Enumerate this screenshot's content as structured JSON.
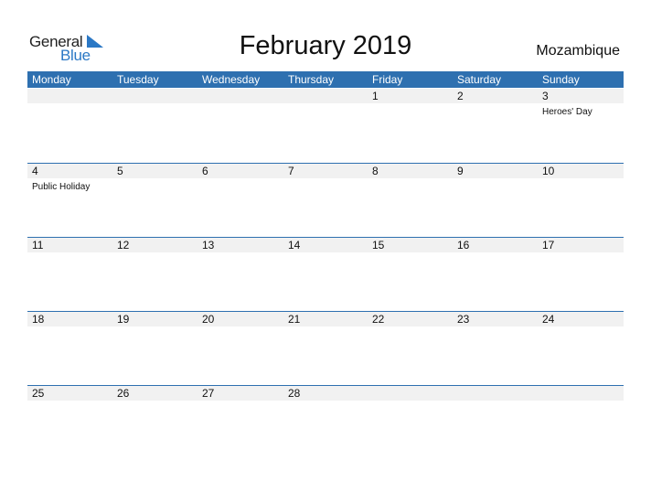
{
  "logo": {
    "line1": "General",
    "line2": "Blue",
    "accent_color": "#2b78c5"
  },
  "title": "February 2019",
  "country": "Mozambique",
  "header_color": "#2e70b0",
  "weekdays": [
    "Monday",
    "Tuesday",
    "Wednesday",
    "Thursday",
    "Friday",
    "Saturday",
    "Sunday"
  ],
  "weeks": [
    [
      {
        "day": ""
      },
      {
        "day": ""
      },
      {
        "day": ""
      },
      {
        "day": ""
      },
      {
        "day": "1"
      },
      {
        "day": "2"
      },
      {
        "day": "3",
        "holiday": "Heroes' Day"
      }
    ],
    [
      {
        "day": "4",
        "holiday": "Public Holiday"
      },
      {
        "day": "5"
      },
      {
        "day": "6"
      },
      {
        "day": "7"
      },
      {
        "day": "8"
      },
      {
        "day": "9"
      },
      {
        "day": "10"
      }
    ],
    [
      {
        "day": "11"
      },
      {
        "day": "12"
      },
      {
        "day": "13"
      },
      {
        "day": "14"
      },
      {
        "day": "15"
      },
      {
        "day": "16"
      },
      {
        "day": "17"
      }
    ],
    [
      {
        "day": "18"
      },
      {
        "day": "19"
      },
      {
        "day": "20"
      },
      {
        "day": "21"
      },
      {
        "day": "22"
      },
      {
        "day": "23"
      },
      {
        "day": "24"
      }
    ],
    [
      {
        "day": "25"
      },
      {
        "day": "26"
      },
      {
        "day": "27"
      },
      {
        "day": "28"
      },
      {
        "day": ""
      },
      {
        "day": ""
      },
      {
        "day": ""
      }
    ]
  ]
}
